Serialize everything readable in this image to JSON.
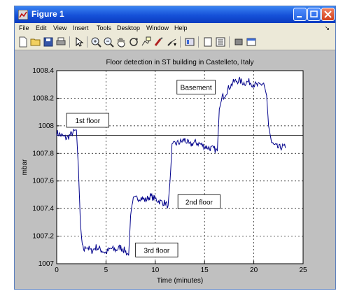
{
  "window": {
    "title": "Figure 1",
    "colors": {
      "titlebar": "#1a56dc",
      "figure_bg": "#c0c0c0",
      "trace": "#00008b"
    }
  },
  "menubar": {
    "items": [
      "File",
      "Edit",
      "View",
      "Insert",
      "Tools",
      "Desktop",
      "Window",
      "Help"
    ],
    "overflow_icon": "menu-arrow-icon"
  },
  "toolbar": {
    "icons": [
      "new-file-icon",
      "open-folder-icon",
      "save-icon",
      "print-icon",
      "pointer-arrow-icon",
      "zoom-in-icon",
      "zoom-out-icon",
      "pan-hand-icon",
      "rotate-3d-icon",
      "data-cursor-icon",
      "brush-icon",
      "link-icon",
      "colorbar-icon",
      "legend-icon",
      "hide-plot-tools-icon",
      "show-plot-tools-icon"
    ]
  },
  "chart_data": {
    "type": "line",
    "title": "Floor detection in ST building in Castelleto, Italy",
    "xlabel": "Time (minutes)",
    "ylabel": "mbar",
    "xlim": [
      0,
      25
    ],
    "ylim": [
      1007,
      1008.4
    ],
    "xticks": [
      0,
      5,
      10,
      15,
      20,
      25
    ],
    "xtick_labels": [
      "0",
      "5",
      "10",
      "15",
      "20",
      "25"
    ],
    "yticks": [
      1007,
      1007.2,
      1007.4,
      1007.6,
      1007.8,
      1008,
      1008.2,
      1008.4
    ],
    "ytick_labels": [
      "1007",
      "1007.2",
      "1007.4",
      "1007.6",
      "1007.8",
      "1008",
      "1008.2",
      "1008.4"
    ],
    "grid": true,
    "reference_line": {
      "y": 1007.93
    },
    "series": [
      {
        "x": [
          0,
          0.5,
          1,
          1.5,
          2,
          2.2,
          2.4,
          2.6,
          2.8,
          3,
          3.5,
          4,
          4.5,
          5,
          5.5,
          6,
          6.5,
          7,
          7.3,
          7.5,
          7.7,
          8,
          8.5,
          9,
          9.5,
          10,
          10.5,
          11,
          11.3,
          11.5,
          11.7,
          12,
          12.5,
          13,
          13.5,
          14,
          14.5,
          15,
          15.5,
          16,
          16.3,
          16.5,
          16.8,
          17,
          17.5,
          18,
          18.5,
          19,
          19.5,
          20,
          20.5,
          21,
          21.3,
          21.5,
          21.8,
          22,
          22.5,
          23,
          23.2
        ],
        "y": [
          1007.95,
          1007.93,
          1007.91,
          1007.94,
          1007.97,
          1007.7,
          1007.3,
          1007.12,
          1007.1,
          1007.13,
          1007.09,
          1007.12,
          1007.1,
          1007.08,
          1007.11,
          1007.1,
          1007.12,
          1007.09,
          1007.06,
          1007.35,
          1007.46,
          1007.47,
          1007.48,
          1007.46,
          1007.49,
          1007.47,
          1007.45,
          1007.44,
          1007.42,
          1007.6,
          1007.85,
          1007.87,
          1007.88,
          1007.9,
          1007.86,
          1007.88,
          1007.87,
          1007.85,
          1007.84,
          1007.83,
          1007.82,
          1008.12,
          1008.21,
          1008.22,
          1008.28,
          1008.32,
          1008.33,
          1008.31,
          1008.32,
          1008.3,
          1008.29,
          1008.31,
          1008.22,
          1008.0,
          1007.88,
          1007.86,
          1007.84,
          1007.85,
          1007.84
        ]
      }
    ],
    "annotations": [
      {
        "text": "1st floor",
        "x": 1.0,
        "y": 1008.04
      },
      {
        "text": "Basement",
        "x": 12.2,
        "y": 1008.28
      },
      {
        "text": "2nd floor",
        "x": 12.3,
        "y": 1007.45
      },
      {
        "text": "3rd floor",
        "x": 8.0,
        "y": 1007.1
      }
    ]
  }
}
